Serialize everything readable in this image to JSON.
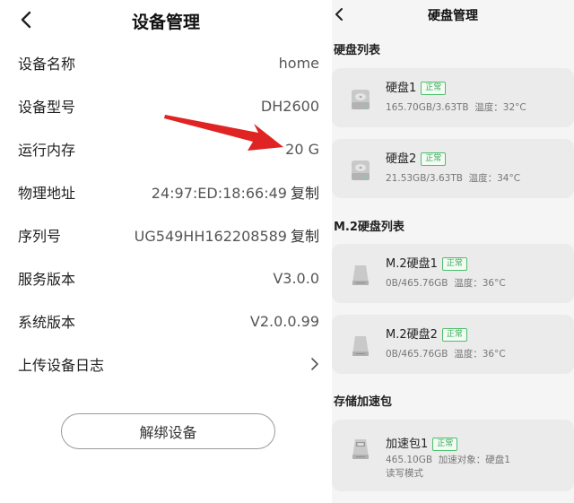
{
  "left": {
    "title": "设备管理",
    "rows": [
      {
        "label": "设备名称",
        "value": "home"
      },
      {
        "label": "设备型号",
        "value": "DH2600"
      },
      {
        "label": "运行内存",
        "value": "20 G"
      },
      {
        "label": "物理地址",
        "value": "24:97:ED:18:66:49",
        "action": "复制"
      },
      {
        "label": "序列号",
        "value": "UG549HH162208589",
        "action": "复制"
      },
      {
        "label": "服务版本",
        "value": "V3.0.0"
      },
      {
        "label": "系统版本",
        "value": "V2.0.0.99"
      },
      {
        "label": "上传设备日志"
      }
    ],
    "unbind_label": "解绑设备",
    "colors": {
      "arrow": "#e02424"
    }
  },
  "right": {
    "title": "硬盘管理",
    "sections": {
      "hdd": "硬盘列表",
      "m2": "M.2硬盘列表",
      "cache": "存储加速包"
    },
    "hdd": [
      {
        "name": "硬盘1",
        "status": "正常",
        "usage": "165.70GB/3.63TB",
        "temp": "温度：32°C"
      },
      {
        "name": "硬盘2",
        "status": "正常",
        "usage": "21.53GB/3.63TB",
        "temp": "温度：34°C"
      }
    ],
    "m2": [
      {
        "name": "M.2硬盘1",
        "status": "正常",
        "usage": "0B/465.76GB",
        "temp": "温度：36°C"
      },
      {
        "name": "M.2硬盘2",
        "status": "正常",
        "usage": "0B/465.76GB",
        "temp": "温度：36°C"
      }
    ],
    "cache": {
      "name": "加速包1",
      "status": "正常",
      "usage": "465.10GB",
      "target": "加速对象：硬盘1",
      "mode": "读写模式"
    },
    "colors": {
      "status_green": "#3aaa58",
      "card_bg": "#ebebeb",
      "panel_bg": "#f5f5f6"
    }
  }
}
